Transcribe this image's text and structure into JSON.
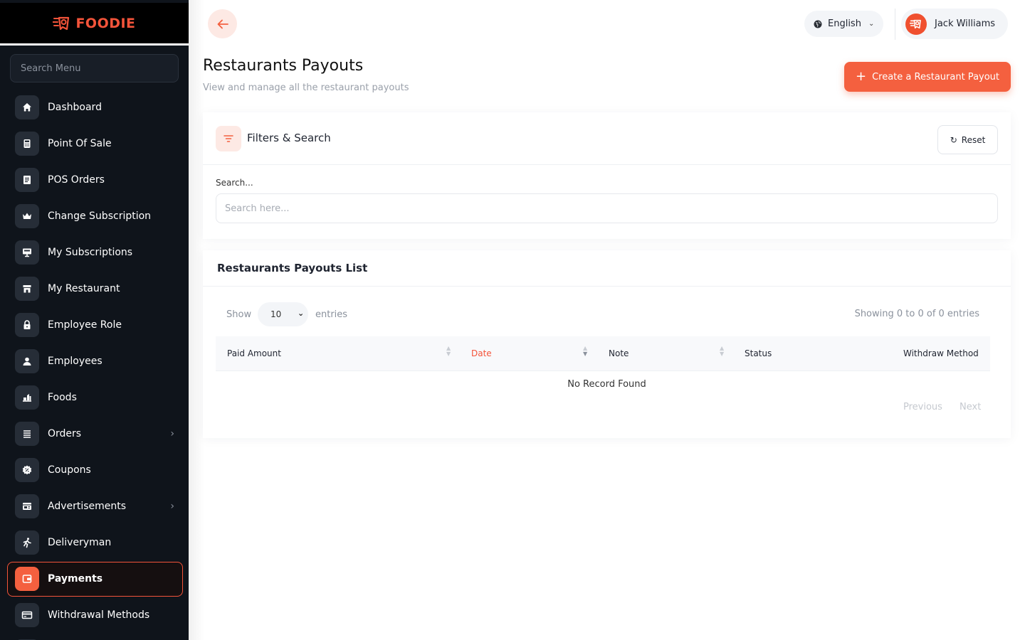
{
  "brand": {
    "name": "FOODIE",
    "color": "#f4543a"
  },
  "sidebar": {
    "search_placeholder": "Search Menu",
    "items": [
      {
        "label": "Dashboard",
        "icon": "home-icon"
      },
      {
        "label": "Point Of Sale",
        "icon": "calculator-icon"
      },
      {
        "label": "POS Orders",
        "icon": "receipt-icon"
      },
      {
        "label": "Change Subscription",
        "icon": "crown-icon"
      },
      {
        "label": "My Subscriptions",
        "icon": "monitor-icon"
      },
      {
        "label": "My Restaurant",
        "icon": "store-icon"
      },
      {
        "label": "Employee Role",
        "icon": "lock-icon"
      },
      {
        "label": "Employees",
        "icon": "user-icon"
      },
      {
        "label": "Foods",
        "icon": "foods-icon"
      },
      {
        "label": "Orders",
        "icon": "list-icon",
        "has_children": true
      },
      {
        "label": "Coupons",
        "icon": "coupon-icon"
      },
      {
        "label": "Advertisements",
        "icon": "ad-icon",
        "has_children": true
      },
      {
        "label": "Deliveryman",
        "icon": "runner-icon"
      },
      {
        "label": "Payments",
        "icon": "wallet-icon",
        "active": true
      },
      {
        "label": "Withdrawal Methods",
        "icon": "card-icon"
      }
    ]
  },
  "topbar": {
    "language": "English",
    "user_name": "Jack Williams"
  },
  "page": {
    "title": "Restaurants Payouts",
    "subtitle": "View and manage all the restaurant payouts",
    "create_button": "Create a Restaurant Payout"
  },
  "filters": {
    "title": "Filters & Search",
    "reset_label": "Reset",
    "search_label": "Search...",
    "search_placeholder": "Search here..."
  },
  "list": {
    "title": "Restaurants Payouts List",
    "show_label": "Show",
    "entries_value": "10",
    "entries_label": "entries",
    "showing_text": "Showing 0 to 0 of 0 entries",
    "columns": [
      "Paid Amount",
      "Date",
      "Note",
      "Status",
      "Withdraw Method"
    ],
    "sorted_column": "Date",
    "empty_text": "No Record Found",
    "prev_label": "Previous",
    "next_label": "Next"
  },
  "colors": {
    "accent": "#f4603f",
    "sidebar_bg": "#0f141b"
  }
}
